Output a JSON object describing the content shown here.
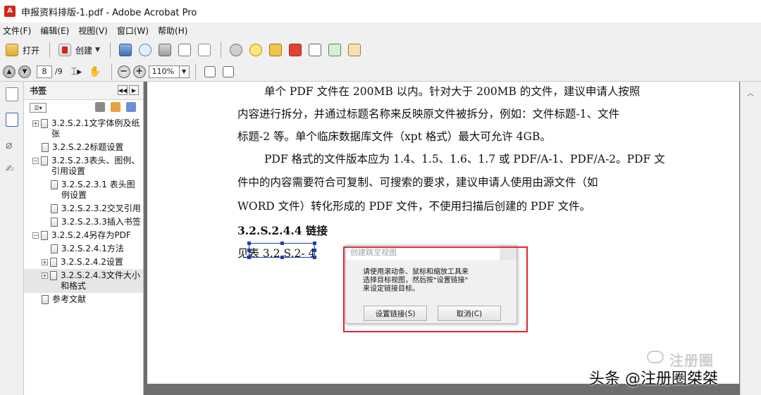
{
  "window": {
    "title": "申报资料排版-1.pdf - Adobe Acrobat Pro"
  },
  "menu": [
    "文件(F)",
    "编辑(E)",
    "视图(V)",
    "窗口(W)",
    "帮助(H)"
  ],
  "toolbar": {
    "open_label": "打开",
    "create_label": "创建"
  },
  "nav": {
    "current_page": "8",
    "total_pages": "/9",
    "zoom": "110%"
  },
  "bookmarks": {
    "title": "书签",
    "items": [
      {
        "label": "3.2.S.2.1文字体例及纸张",
        "expander": "+"
      },
      {
        "label": "3.2.S.2.2标题设置",
        "expander": ""
      },
      {
        "label": "3.2.S.2.3表头、图例、引用设置",
        "expander": "−"
      },
      {
        "label": "3.2.S.2.3.1 表头图例设置",
        "expander": ""
      },
      {
        "label": "3.2.S.2.3.2交叉引用",
        "expander": ""
      },
      {
        "label": "3.2.S.2.3.3插入书签",
        "expander": ""
      },
      {
        "label": "3.2.S.2.4另存为PDF",
        "expander": "−"
      },
      {
        "label": "3.2.S.2.4.1方法",
        "expander": ""
      },
      {
        "label": "3.2.S.2.4.2设置",
        "expander": "+"
      },
      {
        "label": "3.2.S.2.4.3文件大小和格式",
        "expander": "+"
      },
      {
        "label": "参考文献",
        "expander": ""
      }
    ]
  },
  "document": {
    "lines": [
      "单个 PDF 文件在 200MB 以内。针对大于 200MB 的文件，建议申请人按照",
      "内容进行拆分，并通过标题名称来反映原文件被拆分，例如：文件标题-1、文件",
      "标题-2 等。单个临床数据库文件（xpt 格式）最大可允许 4GB。",
      "PDF 格式的文件版本应为 1.4、1.5、1.6、1.7 或 PDF/A-1、PDF/A-2。PDF 文",
      "件中的内容需要符合可复制、可搜索的要求，建议申请人使用由源文件（如",
      "WORD 文件）转化形成的 PDF 文件，不使用扫描后创建的 PDF 文件。"
    ],
    "heading": "3.2.S.2.4.4 链接",
    "link_line": "见表 3.2.S.2- 4"
  },
  "dialog": {
    "title": "创建跳至视图",
    "body": [
      "请使用滚动条、鼠标和缩放工具来",
      "选择目标视图，然后按\"设置链接\"",
      "来设定链接目标。"
    ],
    "set_link_label": "设置链接(S)",
    "cancel_label": "取消(C)"
  },
  "watermark": {
    "account": "注册圈",
    "credit": "头条 @注册圈桀桀"
  }
}
